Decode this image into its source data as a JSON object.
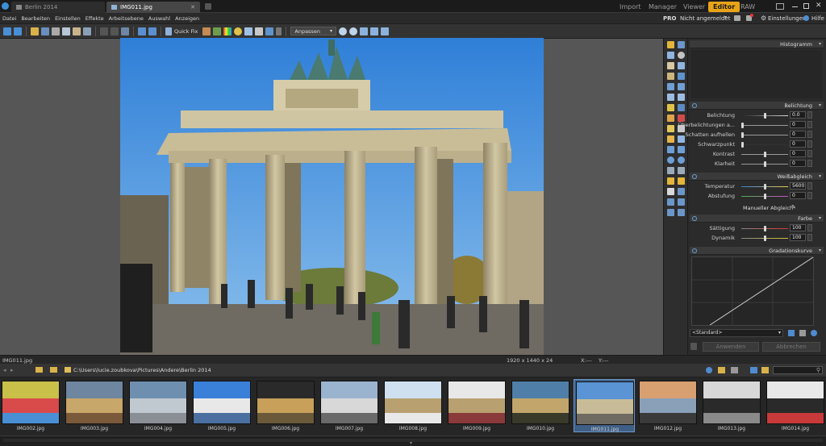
{
  "tabs": [
    {
      "label": "Berlin 2014",
      "active": false
    },
    {
      "label": "IMG011.jpg",
      "active": true
    }
  ],
  "modes": [
    "Import",
    "Manager",
    "Viewer",
    "Editor",
    "RAW"
  ],
  "active_mode": "Editor",
  "menu": [
    "Datei",
    "Bearbeiten",
    "Einstellen",
    "Effekte",
    "Arbeitsebene",
    "Auswahl",
    "Anzeigen"
  ],
  "account": {
    "pro": "PRO",
    "login": "Nicht angemeldet",
    "settings": "Einstellungen",
    "help": "Hilfe"
  },
  "toolbar": {
    "quick_fix": "Quick Fix",
    "fit": "Anpassen"
  },
  "panel": {
    "histogram": "Histogramm",
    "exposure": {
      "title": "Belichtung",
      "rows": [
        {
          "label": "Belichtung",
          "value": "0.0",
          "pos": 0.5
        },
        {
          "label": "Überbelichtungen a...",
          "value": "0",
          "pos": 0.0
        },
        {
          "label": "Schatten aufhellen",
          "value": "0",
          "pos": 0.0
        },
        {
          "label": "Schwarzpunkt",
          "value": "0",
          "pos": 0.0
        },
        {
          "label": "Kontrast",
          "value": "0",
          "pos": 0.5
        },
        {
          "label": "Klarheit",
          "value": "0",
          "pos": 0.5
        }
      ]
    },
    "wb": {
      "title": "Weißabgleich",
      "rows": [
        {
          "label": "Temperatur",
          "value": "5600",
          "pos": 0.5
        },
        {
          "label": "Abstufung",
          "value": "0",
          "pos": 0.5
        }
      ],
      "manual": "Manueller Abgleich"
    },
    "color": {
      "title": "Farbe",
      "rows": [
        {
          "label": "Sättigung",
          "value": "100",
          "pos": 0.5
        },
        {
          "label": "Dynamik",
          "value": "100",
          "pos": 0.5
        }
      ]
    },
    "curve": "Gradationskurve",
    "preset": "<Standard>",
    "apply": "Anwenden",
    "cancel": "Abbrechen"
  },
  "status": {
    "filename": "IMG011.jpg",
    "dimensions": "1920 x 1440 x 24",
    "xcoord": "X:---",
    "ycoord": "Y:---"
  },
  "path": "C:\\Users\\lucie.zoubkova\\Pictures\\Andere\\Berlin 2014",
  "thumbnails": [
    {
      "name": "IMG002.jpg",
      "selected": false
    },
    {
      "name": "IMG003.jpg",
      "selected": false
    },
    {
      "name": "IMG004.jpg",
      "selected": false
    },
    {
      "name": "IMG005.jpg",
      "selected": false
    },
    {
      "name": "IMG006.jpg",
      "selected": false
    },
    {
      "name": "IMG007.jpg",
      "selected": false
    },
    {
      "name": "IMG008.jpg",
      "selected": false
    },
    {
      "name": "IMG009.jpg",
      "selected": false
    },
    {
      "name": "IMG010.jpg",
      "selected": false
    },
    {
      "name": "IMG011.jpg",
      "selected": true
    },
    {
      "name": "IMG012.jpg",
      "selected": false
    },
    {
      "name": "IMG013.jpg",
      "selected": false
    },
    {
      "name": "IMG014.jpg",
      "selected": false
    }
  ],
  "colors": {
    "accent": "#e8a317",
    "selection": "#3f5f86",
    "sky": "#4f93d6",
    "stone": "#c7bc99"
  }
}
